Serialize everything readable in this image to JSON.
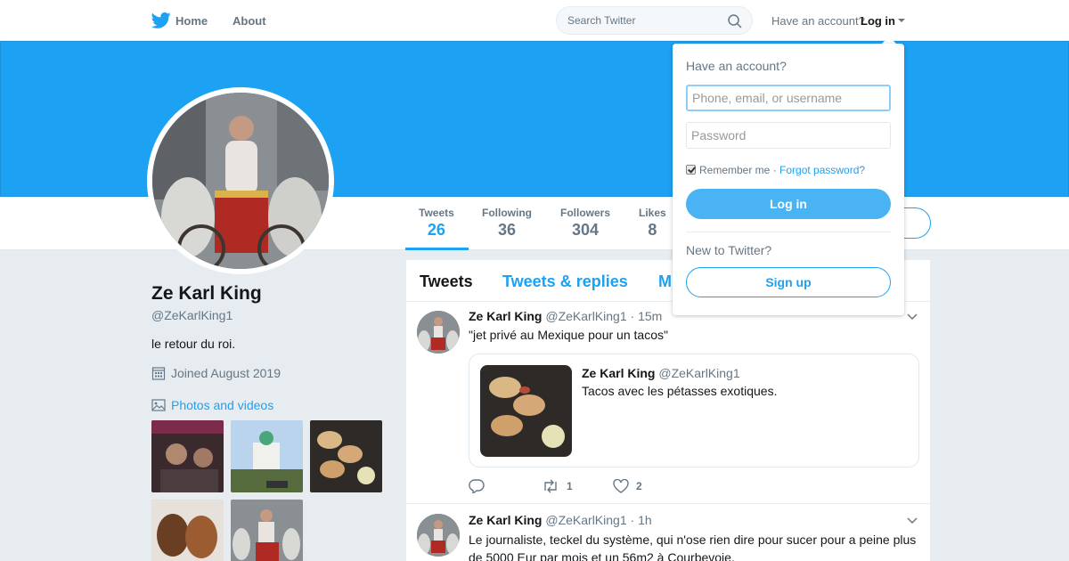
{
  "nav": {
    "home_label": "Home",
    "about_label": "About",
    "search_placeholder": "Search Twitter",
    "have_account": "Have an account?",
    "login_label": "Log in"
  },
  "profile": {
    "name": "Ze Karl King",
    "handle": "@ZeKarlKing1",
    "bio": "le retour du roi.",
    "joined": "Joined August 2019",
    "photos_label": "Photos and videos"
  },
  "stats": [
    {
      "label": "Tweets",
      "value": "26"
    },
    {
      "label": "Following",
      "value": "36"
    },
    {
      "label": "Followers",
      "value": "304"
    },
    {
      "label": "Likes",
      "value": "8"
    }
  ],
  "timeline": {
    "tabs": [
      "Tweets",
      "Tweets & replies",
      "M"
    ],
    "tweets": [
      {
        "name": "Ze Karl King",
        "handle": "@ZeKarlKing1",
        "time": "· 15m",
        "text": "\"jet privé au Mexique pour un tacos\"",
        "quote": {
          "name": "Ze Karl King",
          "handle": "@ZeKarlKing1",
          "text": "Tacos avec les pétasses exotiques."
        },
        "retweets": "1",
        "likes": "2"
      },
      {
        "name": "Ze Karl King",
        "handle": "@ZeKarlKing1",
        "time": "· 1h",
        "text": "Le journaliste, teckel du système, qui n'ose rien dire pour sucer pour a peine plus de 5000 Eur par mois et un 56m2 à Courbevoie."
      }
    ]
  },
  "login_dropdown": {
    "title": "Have an account?",
    "username_placeholder": "Phone, email, or username",
    "password_placeholder": "Password",
    "remember_label": "Remember me",
    "separator": " · ",
    "forgot_label": "Forgot password?",
    "login_button": "Log in",
    "new_label": "New to Twitter?",
    "signup_button": "Sign up"
  },
  "colors": {
    "accent": "#1da1f2",
    "banner": "#1da1f2",
    "page_bg": "#e6ecf0",
    "login_button": "#4ab3f4"
  },
  "icons": [
    "twitter-bird-icon",
    "search-icon",
    "caret-down-icon",
    "calendar-icon",
    "photo-icon",
    "reply-icon",
    "retweet-icon",
    "heart-icon",
    "chevron-down-icon"
  ]
}
